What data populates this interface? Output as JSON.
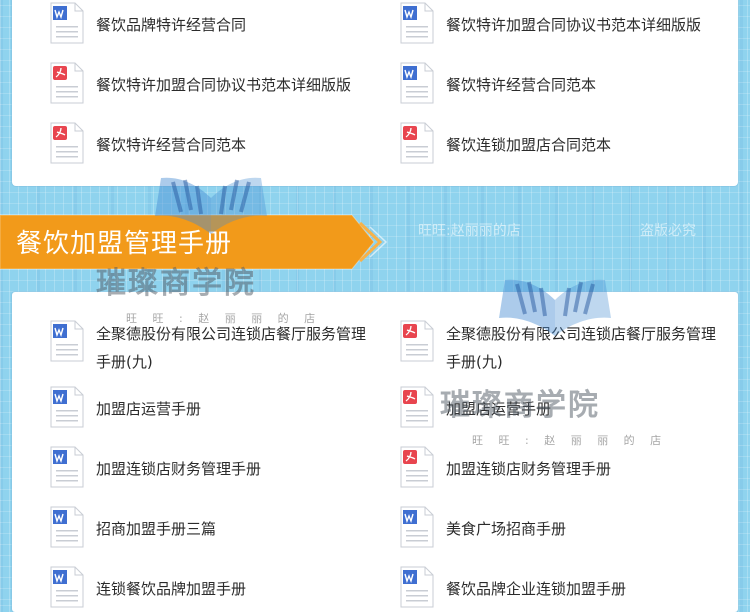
{
  "section": {
    "title": "餐饮加盟管理手册",
    "faint_texts": [
      "的店",
      "旺旺:赵丽丽的店",
      "盗版必究"
    ]
  },
  "watermark": {
    "brand": "璀璨商学院",
    "sub": "旺 旺 : 赵 丽 丽 的 店"
  },
  "colors": {
    "banner": "#f29a1a",
    "word": "#3f6fd1",
    "pdf": "#e8454f"
  },
  "top_files": [
    {
      "label": "餐饮品牌特许经营合同",
      "type": "word"
    },
    {
      "label": "餐饮特许加盟合同协议书范本详细版版",
      "type": "word"
    },
    {
      "label": "餐饮特许加盟合同协议书范本详细版版",
      "type": "pdf"
    },
    {
      "label": "餐饮特许经营合同范本",
      "type": "word"
    },
    {
      "label": "餐饮特许经营合同范本",
      "type": "pdf"
    },
    {
      "label": "餐饮连锁加盟店合同范本",
      "type": "pdf"
    }
  ],
  "bottom_files": [
    {
      "label": "全聚德股份有限公司连锁店餐厅服务管理手册(九)",
      "type": "word"
    },
    {
      "label": "全聚德股份有限公司连锁店餐厅服务管理手册(九)",
      "type": "pdf"
    },
    {
      "label": "加盟店运营手册",
      "type": "word"
    },
    {
      "label": "加盟店运营手册",
      "type": "pdf"
    },
    {
      "label": "加盟连锁店财务管理手册",
      "type": "word"
    },
    {
      "label": "加盟连锁店财务管理手册",
      "type": "pdf"
    },
    {
      "label": "招商加盟手册三篇",
      "type": "word"
    },
    {
      "label": "美食广场招商手册",
      "type": "word"
    },
    {
      "label": "连锁餐饮品牌加盟手册",
      "type": "word"
    },
    {
      "label": "餐饮品牌企业连锁加盟手册",
      "type": "word"
    }
  ]
}
